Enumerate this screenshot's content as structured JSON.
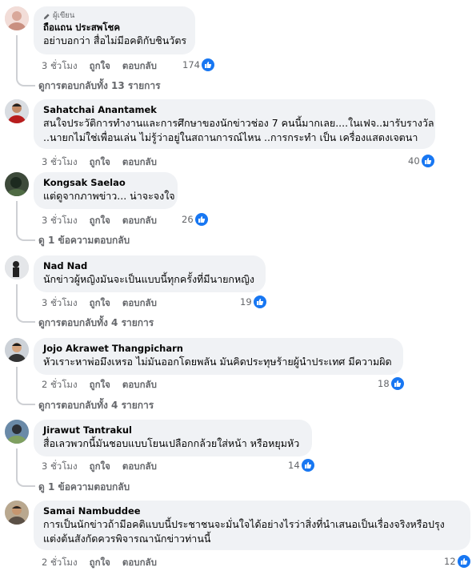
{
  "labels": {
    "time_suffix": "ชั่วโมง",
    "like": "ถูกใจ",
    "reply": "ตอบกลับ",
    "author_badge": "ผู้เขียน"
  },
  "comments": [
    {
      "author": "ถือแถน ประสพโชค",
      "badge": true,
      "lines": [
        "อย่าบอกว่า สื่อไม่มีอคติกับชินวัตร"
      ],
      "time": "3 ชั่วโมง",
      "likes": "174",
      "replies": "ดูการตอบกลับทั้ง 13 รายการ"
    },
    {
      "author": "Sahatchai Anantamek",
      "lines": [
        "สนใจประวัติการทำงานและการศึกษาของนักข่าวช่อง 7 คนนี้มากเลย....ในเฟจ..มารับรางวัล",
        "..นายกไม่ใช่เพื่อนเล่น ไม่รู้ว่าอยู่ในสถานการณ์ไหน ..การกระทำ เป็น เครื่องแสดงเจตนา"
      ],
      "time": "3 ชั่วโมง",
      "likes": "40"
    },
    {
      "author": "Kongsak Saelao",
      "lines": [
        "แต่ดูจากภาพข่าว... น่าจะจงใจ"
      ],
      "time": "3 ชั่วโมง",
      "likes": "26",
      "replies": "ดู 1 ข้อความตอบกลับ"
    },
    {
      "author": "Nad Nad",
      "lines": [
        "นักข่าวผู้หญิงมันจะเป็นแบบนี้ทุกครั้งที่มีนายกหญิง"
      ],
      "time": "3 ชั่วโมง",
      "likes": "19",
      "replies": "ดูการตอบกลับทั้ง 4 รายการ"
    },
    {
      "author": "Jojo Akrawet Thangpicharn",
      "lines": [
        "หัวเราะหาพ่อมึงเหรอ ไม่มันออกโดยพลัน มันคิดประทุษร้ายผู้นำประเทศ มีความผิด"
      ],
      "time": "2 ชั่วโมง",
      "likes": "18",
      "replies": "ดูการตอบกลับทั้ง 4 รายการ"
    },
    {
      "author": "Jirawut Tantrakul",
      "lines": [
        "สื่อเลวพวกนี้มันชอบแบบโยนเปลือกกล้วยใส่หน้า หรือหยุมหัว"
      ],
      "time": "3 ชั่วโมง",
      "likes": "14",
      "replies": "ดู 1 ข้อความตอบกลับ"
    },
    {
      "author": "Samai Nambuddee",
      "lines": [
        "การเป็นนักข่าวถ้ามีอคติแบบนี้ประชาชนจะมั่นใจได้อย่างไรว่าสิ่งที่นำเสนอเป็นเรื่องจริงหรือปรุง",
        "แต่งต้นสังกัดควรพิจารณานักข่าวท่านนี้"
      ],
      "time": "2 ชั่วโมง",
      "likes": "12"
    }
  ],
  "colors": {
    "like_blue": "#1877f2",
    "bubble": "#f0f2f5",
    "meta": "#65676b"
  }
}
